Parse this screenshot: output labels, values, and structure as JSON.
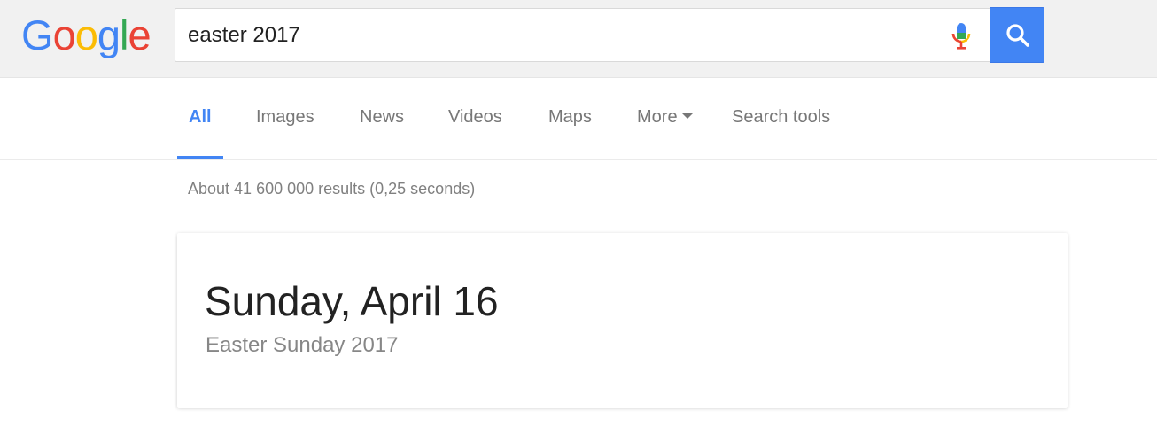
{
  "header": {
    "logo_letters": [
      "G",
      "o",
      "o",
      "g",
      "l",
      "e"
    ],
    "search_query": "easter 2017",
    "mic_icon": "microphone-icon",
    "search_icon": "magnifier-icon",
    "accent_color": "#4285F4"
  },
  "tabs": [
    {
      "label": "All",
      "active": true
    },
    {
      "label": "Images",
      "active": false
    },
    {
      "label": "News",
      "active": false
    },
    {
      "label": "Videos",
      "active": false
    },
    {
      "label": "Maps",
      "active": false
    },
    {
      "label": "More",
      "active": false
    },
    {
      "label": "Search tools",
      "active": false
    }
  ],
  "results": {
    "stats": "About 41 600 000 results (0,25 seconds)"
  },
  "answer_card": {
    "main": "Sunday, April 16",
    "sub": "Easter Sunday 2017"
  }
}
